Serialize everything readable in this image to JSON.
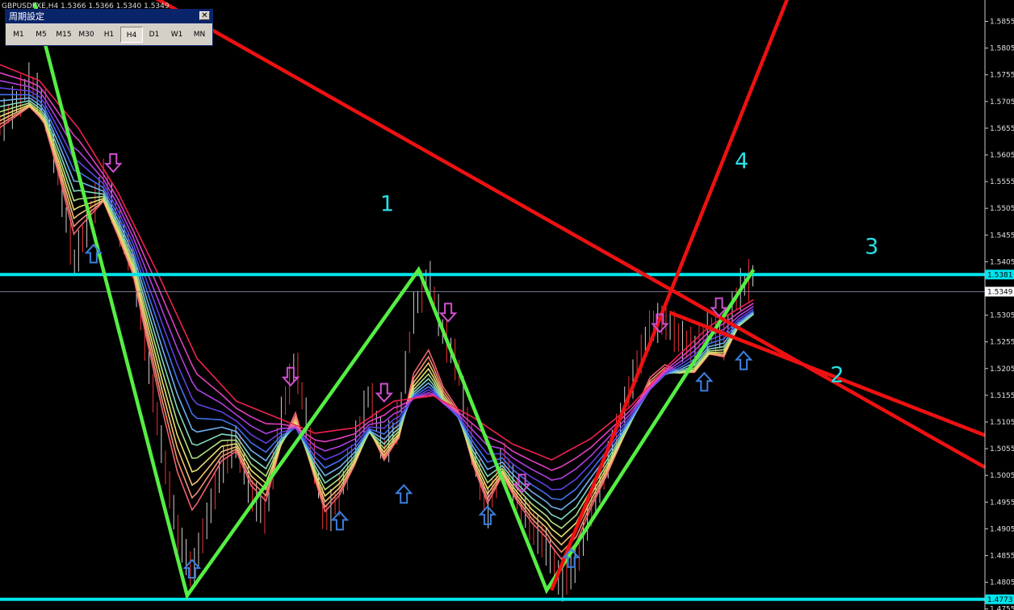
{
  "window": {
    "symbol_title": "GBPUSDFXE,H4  1.5366 1.5366 1.5340 1.5349"
  },
  "timeframe_panel": {
    "title": "周期設定",
    "close_glyph": "✕",
    "buttons": [
      "M1",
      "M5",
      "M15",
      "M30",
      "H1",
      "H4",
      "D1",
      "W1",
      "MN"
    ],
    "active": "H4"
  },
  "chart_data": {
    "type": "line",
    "title": "",
    "symbol": "GBPUSDFXE",
    "timeframe": "H4",
    "yaxis_side": "right",
    "ylim": [
      1.4753,
      1.5895
    ],
    "y_ticks": [
      "1.5855",
      "1.5805",
      "1.5755",
      "1.5705",
      "1.5655",
      "1.5605",
      "1.5555",
      "1.5505",
      "1.5455",
      "1.5405",
      "1.5305",
      "1.5255",
      "1.5205",
      "1.5155",
      "1.5105",
      "1.5055",
      "1.5005",
      "1.4955",
      "1.4905",
      "1.4855",
      "1.4805",
      "1.4755"
    ],
    "x_range": [
      0,
      100
    ],
    "horizontal_lines": [
      {
        "price": 1.5381,
        "label": "1.5381",
        "color": "#00e5ee"
      },
      {
        "price": 1.4773,
        "label": "1.4773",
        "color": "#00e5ee"
      }
    ],
    "current_price": {
      "price": 1.5349,
      "label": "1.5349"
    },
    "price_series": {
      "x": [
        0,
        1.5,
        3,
        4.5,
        6,
        7.5,
        9,
        10.5,
        12,
        13.5,
        15,
        16.5,
        18,
        19.5,
        21,
        22.5,
        24,
        25.5,
        27,
        28.5,
        30,
        31.5,
        33,
        34.5,
        36,
        37.5,
        39,
        40.5,
        42,
        43.5,
        45,
        46.5,
        48,
        49.5,
        51,
        52.5,
        54,
        55.5,
        57,
        58.5,
        60,
        61.5,
        63,
        64.5,
        66,
        67.5,
        69,
        70.5,
        72,
        73.5,
        75,
        76.5
      ],
      "y": [
        1.566,
        1.57,
        1.574,
        1.57,
        1.556,
        1.54,
        1.548,
        1.556,
        1.548,
        1.54,
        1.522,
        1.505,
        1.49,
        1.482,
        1.492,
        1.502,
        1.507,
        1.497,
        1.493,
        1.511,
        1.522,
        1.507,
        1.492,
        1.497,
        1.506,
        1.516,
        1.505,
        1.511,
        1.531,
        1.538,
        1.527,
        1.521,
        1.505,
        1.494,
        1.504,
        1.497,
        1.491,
        1.487,
        1.48,
        1.484,
        1.494,
        1.502,
        1.511,
        1.52,
        1.528,
        1.53,
        1.526,
        1.524,
        1.528,
        1.526,
        1.535,
        1.538
      ]
    },
    "ma_ribbon": {
      "offsets": [
        -0.0045,
        -0.003,
        -0.0015,
        0,
        0.0015,
        0.003,
        0.0045,
        0.006,
        0.0075,
        0.009,
        0.0105,
        0.012
      ],
      "colors": [
        "#f06070",
        "#f09070",
        "#f0c070",
        "#e8e070",
        "#b0e080",
        "#80d8c0",
        "#70b0f0",
        "#4070f0",
        "#6040e0",
        "#b040e0",
        "#e040c0",
        "#f02050"
      ]
    },
    "ribbon_center": {
      "x": [
        0,
        4,
        8,
        12,
        16,
        20,
        24,
        28,
        32,
        36,
        40,
        44,
        48,
        52,
        56,
        60,
        64,
        68,
        72,
        76.5
      ],
      "y": [
        1.569,
        1.566,
        1.557,
        1.545,
        1.53,
        1.514,
        1.506,
        1.503,
        1.5,
        1.501,
        1.506,
        1.507,
        1.503,
        1.498,
        1.495,
        1.499,
        1.505,
        1.513,
        1.52,
        1.525
      ]
    },
    "trendlines": [
      {
        "name": "green-wave",
        "color": "#55ee44",
        "points": [
          [
            3.5,
            1.589
          ],
          [
            19.0,
            1.478
          ],
          [
            42.5,
            1.539
          ],
          [
            55.5,
            1.479
          ],
          [
            76.5,
            1.539
          ]
        ]
      },
      {
        "name": "red-downtrend-1",
        "color": "#ee1111",
        "points": [
          [
            8,
            1.598
          ],
          [
            100,
            1.502
          ]
        ]
      },
      {
        "name": "red-downtrend-2",
        "color": "#ee1111",
        "points": [
          [
            68,
            1.531
          ],
          [
            100,
            1.508
          ]
        ]
      },
      {
        "name": "red-uptrend",
        "color": "#ee1111",
        "points": [
          [
            56,
            1.479
          ],
          [
            80,
            1.59
          ]
        ]
      }
    ],
    "arrows_up": [
      [
        9.5,
        1.542
      ],
      [
        19.5,
        1.483
      ],
      [
        34.5,
        1.492
      ],
      [
        41,
        1.497
      ],
      [
        49.5,
        1.493
      ],
      [
        58,
        1.485
      ],
      [
        71.5,
        1.518
      ],
      [
        75.5,
        1.522
      ]
    ],
    "arrows_down": [
      [
        11.5,
        1.559
      ],
      [
        29.5,
        1.519
      ],
      [
        39,
        1.516
      ],
      [
        45.5,
        1.531
      ],
      [
        53,
        1.499
      ],
      [
        67,
        1.529
      ],
      [
        73,
        1.532
      ]
    ],
    "annotations": [
      {
        "text": "1",
        "x": 39.3,
        "y": 1.55
      },
      {
        "text": "2",
        "x": 85,
        "y": 1.518
      },
      {
        "text": "3",
        "x": 88.5,
        "y": 1.542
      },
      {
        "text": "4",
        "x": 75.3,
        "y": 1.558
      }
    ]
  },
  "colors": {
    "background": "#000000",
    "axis": "#c8c8c8",
    "hline": "#00e5ee",
    "arrow_up": "#3b7fe0",
    "arrow_down": "#d050d0",
    "label": "#28e0e8"
  }
}
